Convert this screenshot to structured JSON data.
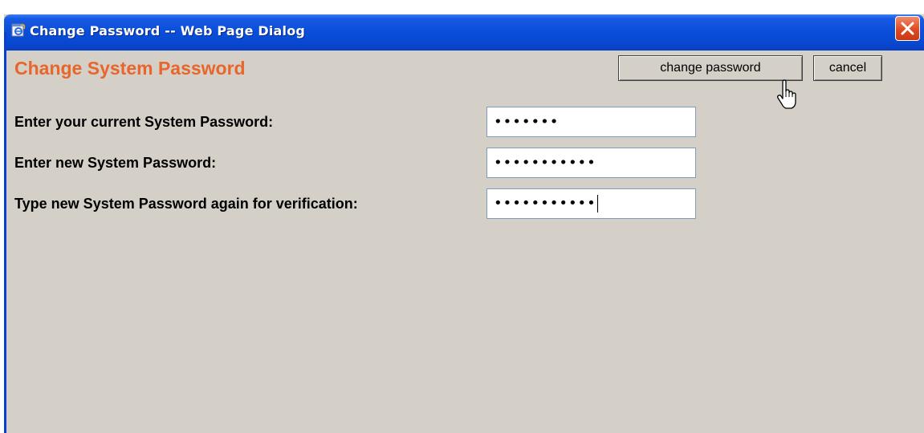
{
  "window": {
    "title": "Change Password -- Web Page Dialog",
    "icon": "ie-page-icon"
  },
  "form": {
    "heading": "Change System Password",
    "accent_color": "#e8662c",
    "change_button_label": "change password",
    "cancel_button_label": "cancel",
    "fields": [
      {
        "label": "Enter your current System Password:",
        "masked_value": "•••••••",
        "type": "password"
      },
      {
        "label": "Enter new System Password:",
        "masked_value": "•••••••••••",
        "type": "password"
      },
      {
        "label": "Type new System Password again for verification:",
        "masked_value": "•••••••••••",
        "type": "password",
        "focused": true
      }
    ]
  },
  "cursor": {
    "icon": "hand-pointer-icon",
    "over": "change password"
  }
}
